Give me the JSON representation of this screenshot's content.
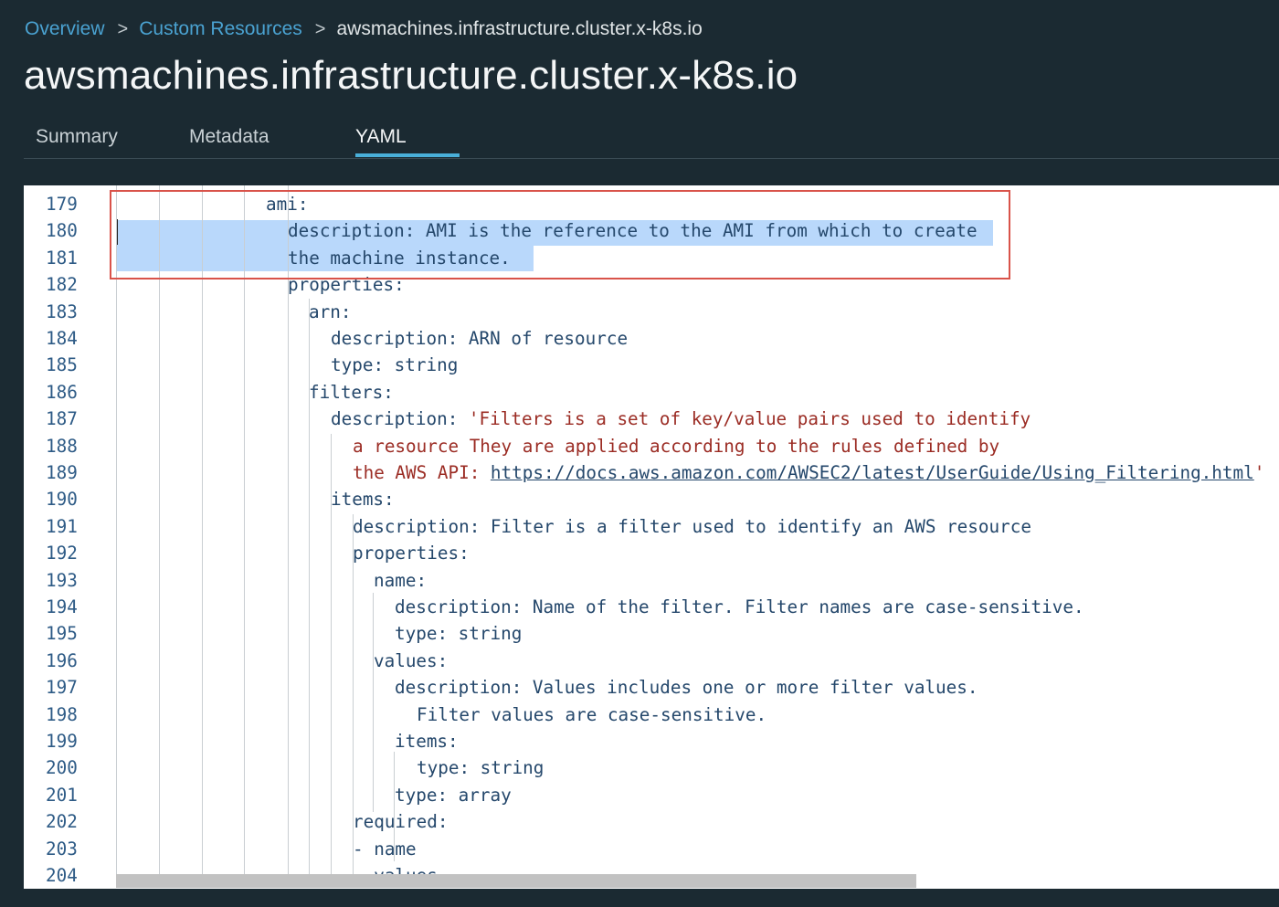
{
  "breadcrumb": {
    "overview": "Overview",
    "custom_resources": "Custom Resources",
    "current": "awsmachines.infrastructure.cluster.x-k8s.io",
    "sep": ">"
  },
  "page_title": "awsmachines.infrastructure.cluster.x-k8s.io",
  "tabs": [
    "Summary",
    "Metadata",
    "YAML"
  ],
  "active_tab": "YAML",
  "editor": {
    "lines": [
      {
        "n": "179",
        "key": "ami",
        "sep": ":",
        "val": ""
      },
      {
        "n": "180",
        "key": "description",
        "sep": ": ",
        "val": "AMI is the reference to the AMI from which to create"
      },
      {
        "n": "181",
        "key": "",
        "sep": "",
        "val": "the machine instance."
      },
      {
        "n": "182",
        "key": "properties",
        "sep": ":",
        "val": ""
      },
      {
        "n": "183",
        "key": "arn",
        "sep": ":",
        "val": ""
      },
      {
        "n": "184",
        "key": "description",
        "sep": ": ",
        "val": "ARN of resource"
      },
      {
        "n": "185",
        "key": "type",
        "sep": ": ",
        "val": "string"
      },
      {
        "n": "186",
        "key": "filters",
        "sep": ":",
        "val": ""
      },
      {
        "n": "187",
        "key": "description",
        "sep": ": ",
        "val": "'Filters is a set of key/value pairs used to identify"
      },
      {
        "n": "188",
        "key": "",
        "sep": "",
        "val": "a resource They are applied according to the rules defined by"
      },
      {
        "n": "189",
        "key": "",
        "sep": "",
        "val": "the AWS API: ",
        "link": "https://docs.aws.amazon.com/AWSEC2/latest/UserGuide/Using_Filtering.html",
        "tail": "'"
      },
      {
        "n": "190",
        "key": "items",
        "sep": ":",
        "val": ""
      },
      {
        "n": "191",
        "key": "description",
        "sep": ": ",
        "val": "Filter is a filter used to identify an AWS resource"
      },
      {
        "n": "192",
        "key": "properties",
        "sep": ":",
        "val": ""
      },
      {
        "n": "193",
        "key": "name",
        "sep": ":",
        "val": ""
      },
      {
        "n": "194",
        "key": "description",
        "sep": ": ",
        "val": "Name of the filter. Filter names are case-sensitive."
      },
      {
        "n": "195",
        "key": "type",
        "sep": ": ",
        "val": "string"
      },
      {
        "n": "196",
        "key": "values",
        "sep": ":",
        "val": ""
      },
      {
        "n": "197",
        "key": "description",
        "sep": ": ",
        "val": "Values includes one or more filter values."
      },
      {
        "n": "198",
        "key": "",
        "sep": "",
        "val": "Filter values are case-sensitive."
      },
      {
        "n": "199",
        "key": "items",
        "sep": ":",
        "val": ""
      },
      {
        "n": "200",
        "key": "type",
        "sep": ": ",
        "val": "string"
      },
      {
        "n": "201",
        "key": "type",
        "sep": ": ",
        "val": "array"
      },
      {
        "n": "202",
        "key": "required",
        "sep": ":",
        "val": ""
      },
      {
        "n": "203",
        "key": "",
        "sep": "",
        "val": "- name"
      },
      {
        "n": "204",
        "key": "",
        "sep": "",
        "val": "- values"
      }
    ]
  }
}
